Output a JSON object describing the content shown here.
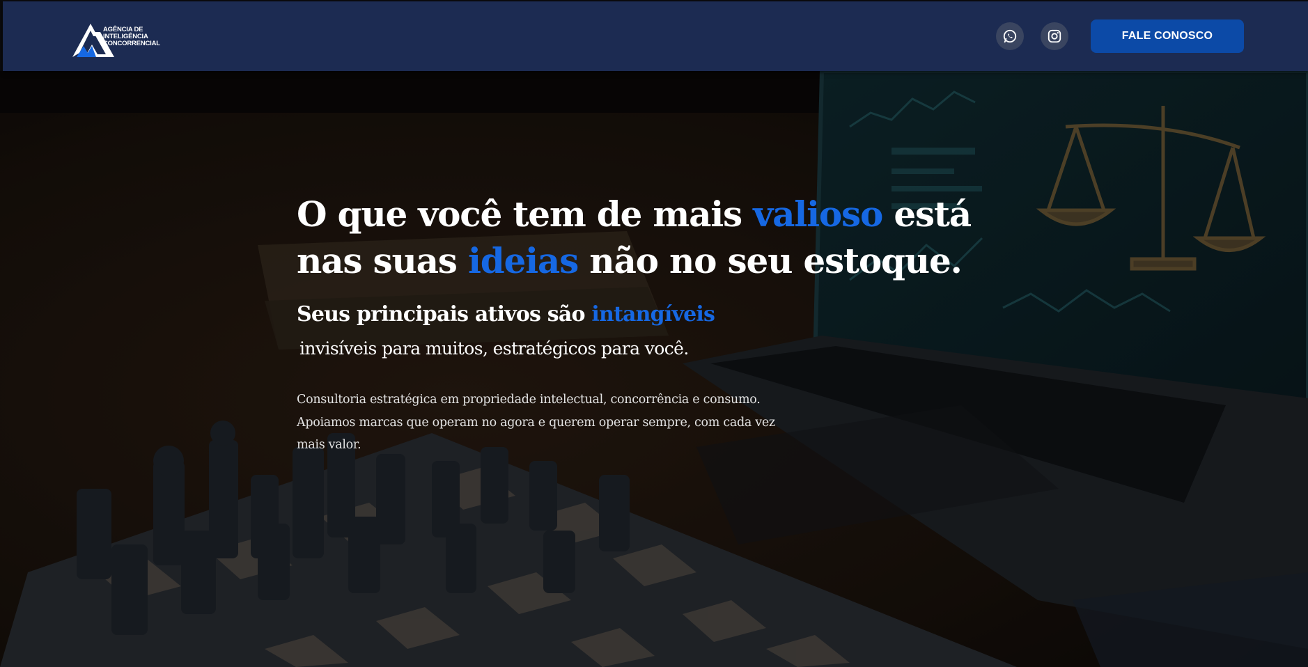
{
  "header": {
    "logo_text": "AGÊNCIA DE\nINTELIGÊNCIA\nCONCORRENCIAL",
    "cta_label": "FALE CONOSCO",
    "social": [
      {
        "icon": "whatsapp-icon"
      },
      {
        "icon": "instagram-icon"
      }
    ]
  },
  "hero": {
    "headline_1": "O que você tem de mais ",
    "headline_accent_1": "valioso",
    "headline_2": " está nas suas ",
    "headline_accent_2": "ideias",
    "headline_3": " não no seu estoque.",
    "sub_1": "Seus principais ativos são ",
    "sub_accent": "intangíveis",
    "sub_2": "invisíveis para muitos, estratégicos para você.",
    "paragraph": "Consultoria estratégica em propriedade intelectual, concorrência e consumo. Apoiamos marcas que operam no agora e querem operar sempre, com cada vez mais valor."
  },
  "colors": {
    "header_bg": "#1c2b52",
    "accent": "#1668e3",
    "cta_bg": "#0c4aa7"
  }
}
